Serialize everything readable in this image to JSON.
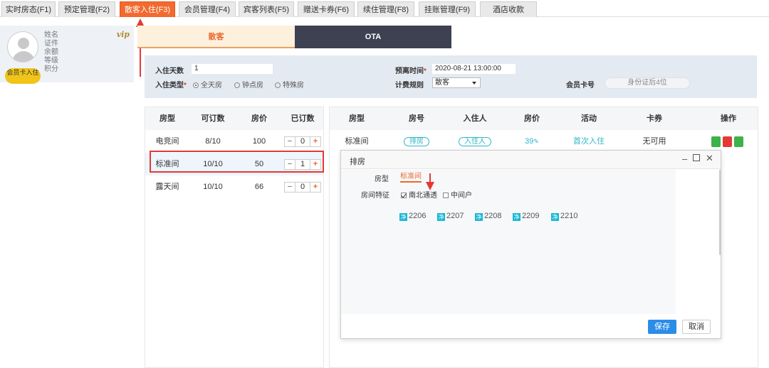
{
  "top_tabs": [
    {
      "label": "实时房态(F1)"
    },
    {
      "label": "预定管理(F2)"
    },
    {
      "label": "散客入住(F3)"
    },
    {
      "label": "会员管理(F4)"
    },
    {
      "label": "宾客列表(F5)"
    },
    {
      "label": "赠送卡券(F6)"
    },
    {
      "label": "续住管理(F8)"
    },
    {
      "label": "挂账管理(F9)"
    },
    {
      "label": "酒店收款"
    }
  ],
  "member": {
    "fields": [
      "姓名",
      "证件",
      "余额",
      "等级",
      "积分"
    ],
    "vip": "vip",
    "card_button": "会员卡入住"
  },
  "segments": {
    "guest": "散客",
    "ota": "OTA"
  },
  "form": {
    "days_label": "入住天数",
    "days_value": "1",
    "type_label": "入住类型",
    "type_options": [
      "全天房",
      "钟点房",
      "特殊房"
    ],
    "checkout_label": "预离时间",
    "checkout_value": "2020-08-21 13:00:00",
    "billing_label": "计费规则",
    "billing_value": "散客",
    "card_label": "会员卡号",
    "card_placeholder": "身份证后4位"
  },
  "room_types": {
    "headers": [
      "房型",
      "可订数",
      "房价",
      "已订数"
    ],
    "rows": [
      {
        "name": "电竞间",
        "avail": "8/10",
        "price": "100",
        "booked": "0"
      },
      {
        "name": "标准间",
        "avail": "10/10",
        "price": "50",
        "booked": "1"
      },
      {
        "name": "露天间",
        "avail": "10/10",
        "price": "66",
        "booked": "0"
      }
    ]
  },
  "booking": {
    "headers": [
      "房型",
      "房号",
      "入住人",
      "房价",
      "活动",
      "卡券",
      "操作"
    ],
    "row": {
      "type": "标准间",
      "room": "排房",
      "guest": "入住人",
      "price": "39",
      "activity": "首次入住",
      "coupon": "无可用"
    }
  },
  "modal": {
    "title": "排房",
    "type_label": "房型",
    "type_value": "标准间",
    "feature_label": "房间特征",
    "features": [
      "南北通透",
      "中间户"
    ],
    "rooms": [
      "2206",
      "2207",
      "2208",
      "2209",
      "2210"
    ],
    "room_badge": "净",
    "save": "保存",
    "cancel": "取消"
  },
  "colors": {
    "accent": "#f26a2e",
    "teal": "#2cb5c9",
    "primary": "#2b8de8",
    "highlight": "#e53935"
  }
}
